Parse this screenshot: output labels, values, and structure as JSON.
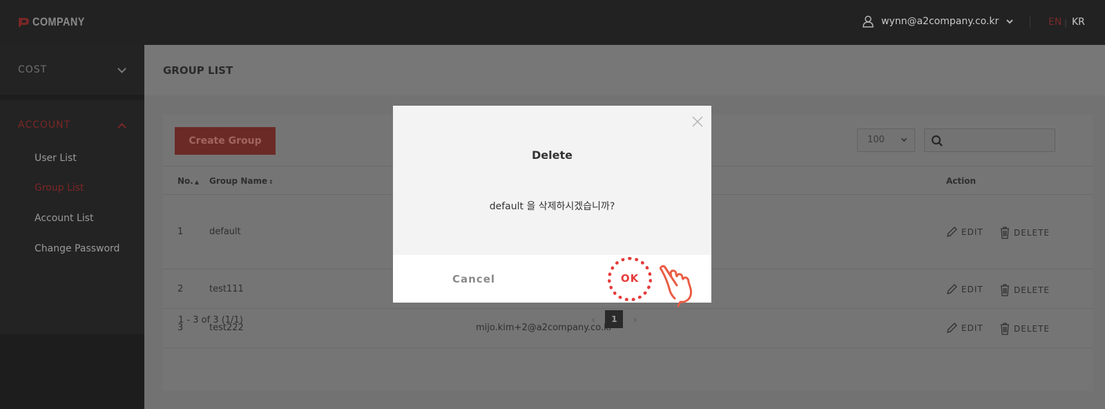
{
  "header": {
    "logo_text": "COMPANY",
    "user_email": "wynn@a2company.co.kr",
    "lang_en": "EN",
    "lang_divider": "|",
    "lang_kr": "KR"
  },
  "sidebar": {
    "cost_label": "COST",
    "account_label": "ACCOUNT",
    "items": [
      {
        "label": "User List"
      },
      {
        "label": "Group List"
      },
      {
        "label": "Account List"
      },
      {
        "label": "Change Password"
      }
    ]
  },
  "main": {
    "page_title": "GROUP LIST",
    "create_button": "Create Group",
    "per_page": "100",
    "search_placeholder": "",
    "columns": {
      "no": "No.",
      "group_name": "Group Name",
      "action": "Action"
    },
    "rows": [
      {
        "no": "1",
        "name": "default",
        "email": ""
      },
      {
        "no": "2",
        "name": "test111",
        "email": ""
      },
      {
        "no": "3",
        "name": "test222",
        "email": "mijo.kim+2@a2company.co.kr"
      }
    ],
    "edit_label": "EDIT",
    "delete_label": "DELETE",
    "summary": "1 - 3 of 3 (1/1)",
    "current_page": "1"
  },
  "modal": {
    "title": "Delete",
    "message": "default 을 삭제하시겠습니까?",
    "cancel_label": "Cancel",
    "ok_label": "OK"
  },
  "colors": {
    "accent": "#e63a3a",
    "header_bg": "#222222",
    "overlay_dim": "#757575"
  }
}
